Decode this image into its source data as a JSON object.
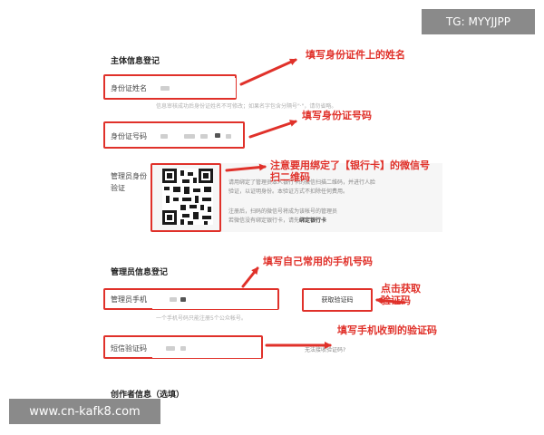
{
  "watermarks": {
    "top": "TG: MYYJJPP",
    "bottom": "www.cn-kafk8.com"
  },
  "subject_section": {
    "title": "主体信息登记",
    "name_label": "身份证姓名",
    "name_hint": "信息审核成功后身份证姓名不可修改；如果名字包含分隔号\"·\"，请勿省略。",
    "id_label": "身份证号码",
    "admin_id_label_line1": "管理员身份",
    "admin_id_label_line2": "验证",
    "qr_text_line1": "请用绑定了管理员本人银行卡的微信扫描二维码，并进行人脸",
    "qr_text_line2": "验证，以证明身份。本验证方式不扣除任何费用。",
    "qr_text_line3": "注册后，扫码的微信号将成为该帐号的管理员",
    "qr_text_line4_prefix": "若微信没有绑定银行卡，请先",
    "qr_text_line4_link": "绑定银行卡"
  },
  "admin_section": {
    "title": "管理员信息登记",
    "phone_label": "管理员手机",
    "get_code_button": "获取验证码",
    "phone_hint": "一个手机号码只能注册5个公众帐号。",
    "sms_label": "短信验证码",
    "no_code_link": "无法接收验证码?"
  },
  "creator_section": {
    "title": "创作者信息（选填）"
  },
  "annotations": {
    "name": "填写身份证件上的姓名",
    "id": "填写身份证号码",
    "qr_line1": "注意要用绑定了【银行卡】的微信号",
    "qr_line2": "扫二维码",
    "phone": "填写自己常用的手机号码",
    "code_line1": "点击获取",
    "code_line2": "验证码",
    "sms": "填写手机收到的验证码"
  },
  "colors": {
    "annotation_red": "#e0312a",
    "watermark_bg": "#8a8a8a"
  }
}
